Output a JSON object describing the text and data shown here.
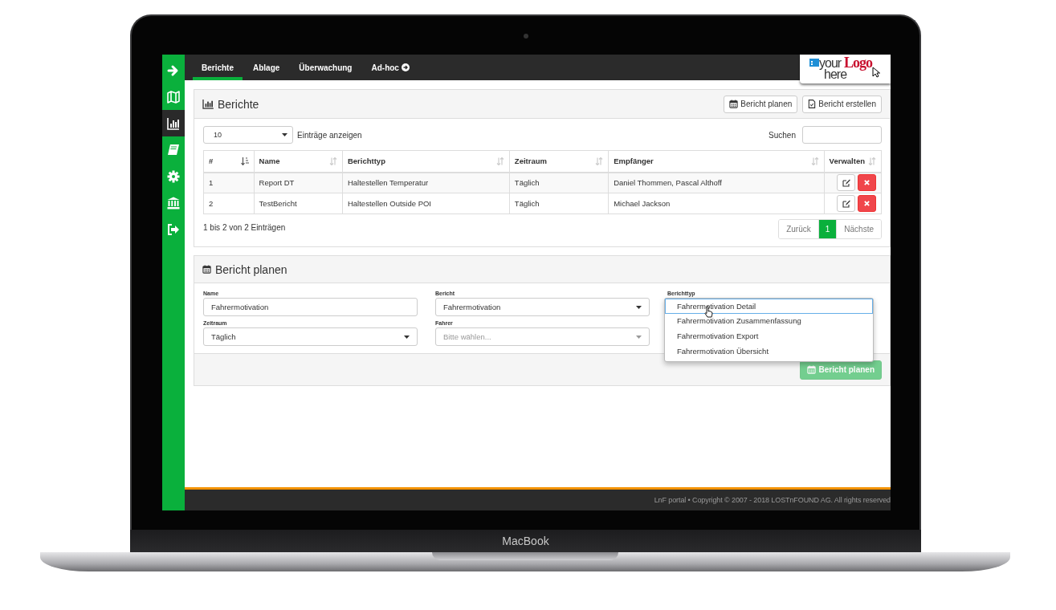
{
  "sidebar": {
    "items": [
      {
        "kind": "arrow",
        "selected": false
      },
      {
        "kind": "map",
        "selected": false
      },
      {
        "kind": "chart",
        "selected": true
      },
      {
        "kind": "book",
        "selected": false
      },
      {
        "kind": "gear",
        "selected": false
      },
      {
        "kind": "bank",
        "selected": false
      },
      {
        "kind": "signout",
        "selected": false
      }
    ]
  },
  "nav": {
    "tabs": [
      {
        "label": "Berichte",
        "selected": true,
        "kind": "plain"
      },
      {
        "label": "Ablage",
        "selected": false,
        "kind": "plain"
      },
      {
        "label": "Überwachung",
        "selected": false,
        "kind": "plain"
      },
      {
        "label": "Ad-hoc",
        "selected": false,
        "kind": "external"
      }
    ]
  },
  "logo": {
    "word_1": "your",
    "word_2": "Logo",
    "word_3": "here"
  },
  "reports_panel": {
    "title": "Berichte",
    "buttons": [
      {
        "label": "Bericht planen",
        "kind": "calendar"
      },
      {
        "label": "Bericht erstellen",
        "kind": "document"
      }
    ],
    "page_size": "10",
    "page_size_label": "Einträge anzeigen",
    "search_label": "Suchen",
    "table": {
      "columns": [
        {
          "label": "#",
          "sorted": true
        },
        {
          "label": "Name",
          "sorted": false
        },
        {
          "label": "Berichttyp",
          "sorted": false
        },
        {
          "label": "Zeitraum",
          "sorted": false
        },
        {
          "label": "Empfänger",
          "sorted": false
        },
        {
          "label": "Verwalten",
          "sorted": false
        }
      ],
      "rows": [
        {
          "cells": [
            "1",
            "Report DT",
            "Haltestellen Temperatur",
            "Täglich",
            "Daniel Thommen, Pascal Althoff"
          ]
        },
        {
          "cells": [
            "2",
            "TestBericht",
            "Haltestellen Outside POI",
            "Täglich",
            "Michael Jackson"
          ]
        }
      ]
    },
    "info": "1 bis 2 von 2 Einträgen",
    "pagination": [
      {
        "label": "Zurück",
        "selected": false
      },
      {
        "label": "1",
        "selected": true
      },
      {
        "label": "Nächste",
        "selected": false
      }
    ]
  },
  "plan_panel": {
    "title": "Bericht planen",
    "fields": [
      {
        "label": "Name",
        "kind": "text",
        "value": "Fahrermotivation"
      },
      {
        "label": "Bericht",
        "kind": "select",
        "value": "Fahrermotivation"
      },
      {
        "label": "Berichttyp",
        "kind": "open",
        "options": [
          {
            "label": "Fahrermotivation Detail",
            "highlighted": true
          },
          {
            "label": "Fahrermotivation Zusammenfassung",
            "highlighted": false
          },
          {
            "label": "Fahrermotivation Export",
            "highlighted": false
          },
          {
            "label": "Fahrermotivation Übersicht",
            "highlighted": false
          }
        ]
      },
      {
        "label": "Zeitraum",
        "kind": "select",
        "value": "Täglich"
      },
      {
        "label": "Fahrer",
        "kind": "select",
        "placeholder": "Bitte wählen..."
      }
    ],
    "submit": {
      "label": "Bericht planen",
      "disabled": true
    }
  },
  "footer": {
    "text": "LnF portal • Copyright © 2007 - 2018 LOSTnFOUND AG. All rights reserved"
  },
  "device": {
    "label": "MacBook"
  }
}
